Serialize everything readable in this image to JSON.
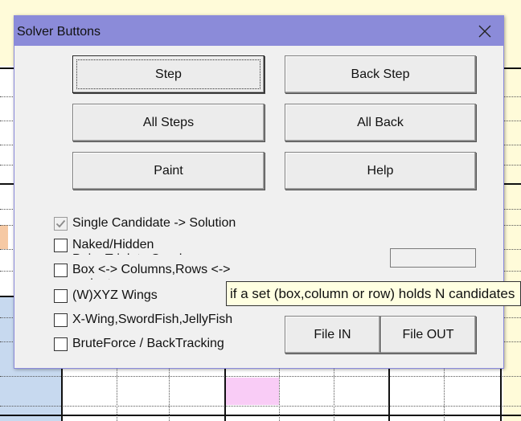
{
  "window": {
    "title": "Solver Buttons"
  },
  "buttons": {
    "step": "Step",
    "back_step": "Back Step",
    "all_steps": "All Steps",
    "all_back": "All Back",
    "paint": "Paint",
    "help": "Help",
    "file_in": "File IN",
    "file_out": "File OUT"
  },
  "options": [
    {
      "label": "Single Candidate -> Solution",
      "checked": true,
      "enabled": false
    },
    {
      "label": "Naked/Hidden Pairs,Triplets,Quads",
      "checked": false,
      "enabled": true
    },
    {
      "label": "Box <-> Columns,Rows <-> variants",
      "checked": false,
      "enabled": true
    },
    {
      "label": "(W)XYZ Wings",
      "checked": false,
      "enabled": true
    },
    {
      "label": "X-Wing,SwordFish,JellyFish",
      "checked": false,
      "enabled": true
    },
    {
      "label": "BruteForce / BackTracking",
      "checked": false,
      "enabled": true
    }
  ],
  "status_box": {
    "value": ""
  },
  "tooltip": {
    "text": "if a set (box,column or row) holds N candidates"
  },
  "icons": {
    "close": "close-icon",
    "check": "checkmark-icon"
  },
  "colors": {
    "titlebar": "#8b8bd9",
    "dialog_bg": "#f0f0f0",
    "tooltip_bg": "#ffffe1",
    "sheet_blue": "#c7d9ef",
    "sheet_pink": "#f9ccf6",
    "sheet_yellow": "#fffbd9"
  }
}
